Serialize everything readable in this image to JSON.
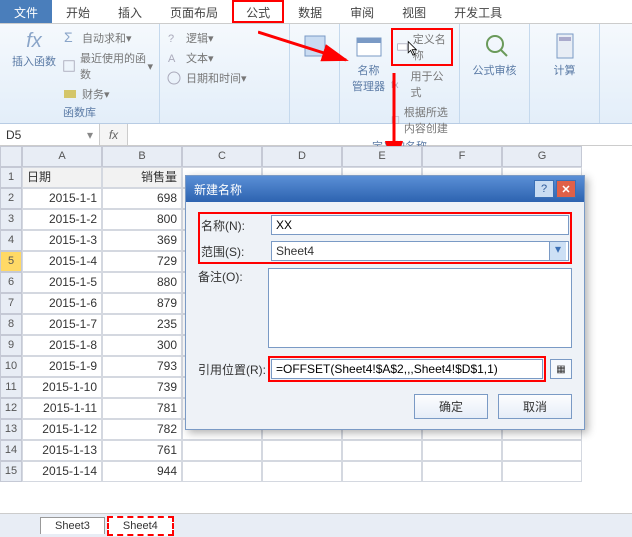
{
  "tabs": {
    "file": "文件",
    "start": "开始",
    "insert": "插入",
    "layout": "页面布局",
    "formula": "公式",
    "data": "数据",
    "review": "审阅",
    "view": "视图",
    "dev": "开发工具"
  },
  "ribbon": {
    "insertFn": "插入函数",
    "autoSum": "自动求和",
    "recent": "最近使用的函数",
    "finance": "财务",
    "logic": "逻辑",
    "text": "文本",
    "datetime": "日期和时间",
    "nameMgr": "名称\n管理器",
    "defineName": "定义名称",
    "useInFormula": "用于公式",
    "createFromSel": "根据所选内容创建",
    "auditFormula": "公式审核",
    "calc": "计算",
    "group1": "函数库",
    "group2": "定义的名称"
  },
  "namebox": "D5",
  "columns": [
    "A",
    "B",
    "C",
    "D",
    "E",
    "F",
    "G"
  ],
  "headers": {
    "date": "日期",
    "sales": "销售量"
  },
  "rows": [
    {
      "n": 1
    },
    {
      "n": 2,
      "date": "2015-1-1",
      "sales": "698"
    },
    {
      "n": 3,
      "date": "2015-1-2",
      "sales": "800"
    },
    {
      "n": 4,
      "date": "2015-1-3",
      "sales": "369"
    },
    {
      "n": 5,
      "date": "2015-1-4",
      "sales": "729"
    },
    {
      "n": 6,
      "date": "2015-1-5",
      "sales": "880"
    },
    {
      "n": 7,
      "date": "2015-1-6",
      "sales": "879"
    },
    {
      "n": 8,
      "date": "2015-1-7",
      "sales": "235"
    },
    {
      "n": 9,
      "date": "2015-1-8",
      "sales": "300"
    },
    {
      "n": 10,
      "date": "2015-1-9",
      "sales": "793"
    },
    {
      "n": 11,
      "date": "2015-1-10",
      "sales": "739"
    },
    {
      "n": 12,
      "date": "2015-1-11",
      "sales": "781"
    },
    {
      "n": 13,
      "date": "2015-1-12",
      "sales": "782"
    },
    {
      "n": 14,
      "date": "2015-1-13",
      "sales": "761"
    },
    {
      "n": 15,
      "date": "2015-1-14",
      "sales": "944"
    }
  ],
  "sheetTabs": {
    "s1": "Sheet3",
    "s2": "Sheet4"
  },
  "dialog": {
    "title": "新建名称",
    "nameLabel": "名称(N):",
    "nameVal": "XX",
    "scopeLabel": "范围(S):",
    "scopeVal": "Sheet4",
    "commentLabel": "备注(O):",
    "refLabel": "引用位置(R):",
    "refVal": "=OFFSET(Sheet4!$A$2,,,Sheet4!$D$1,1)",
    "ok": "确定",
    "cancel": "取消"
  }
}
